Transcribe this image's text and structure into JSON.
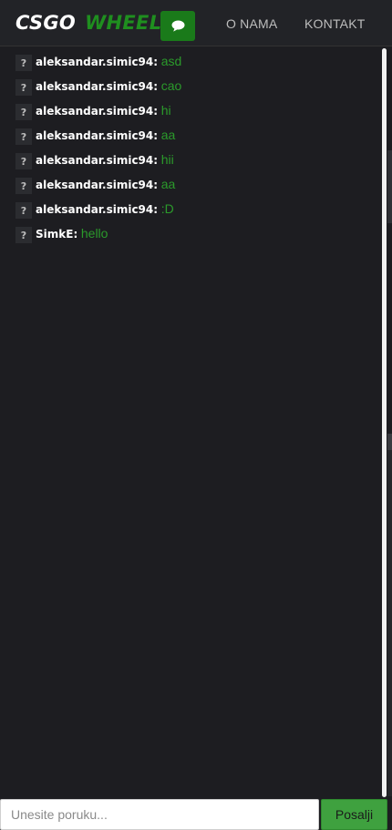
{
  "header": {
    "brand_part1": "CSGO",
    "brand_part2": "WHEEL",
    "chat_icon": "comment-icon",
    "nav": [
      "O NAMA",
      "KONTAKT"
    ]
  },
  "colors": {
    "accent_green": "#1a7a1a",
    "message_green": "#2b9a2b",
    "background": "#1d1d21",
    "header_background": "#222327"
  },
  "chat": {
    "avatar_glyph": "?",
    "messages": [
      {
        "user": "aleksandar.simic94:",
        "text": "asd"
      },
      {
        "user": "aleksandar.simic94:",
        "text": "cao"
      },
      {
        "user": "aleksandar.simic94:",
        "text": "hi"
      },
      {
        "user": "aleksandar.simic94:",
        "text": "aa"
      },
      {
        "user": "aleksandar.simic94:",
        "text": "hii"
      },
      {
        "user": "aleksandar.simic94:",
        "text": "aa"
      },
      {
        "user": "aleksandar.simic94:",
        "text": ":D"
      },
      {
        "user": "SimkE:",
        "text": "hello"
      }
    ]
  },
  "footer": {
    "input_placeholder": "Unesite poruku...",
    "input_value": "",
    "send_label": "Posalji"
  }
}
